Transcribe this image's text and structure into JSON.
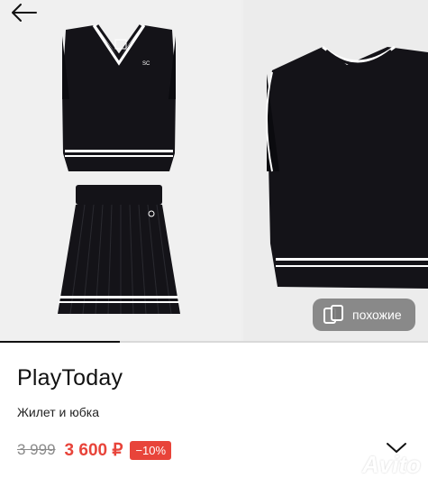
{
  "gallery": {
    "images": [
      {
        "icon": "vest-and-skirt-photo"
      },
      {
        "icon": "vest-closeup-photo"
      }
    ],
    "progress": 0.28,
    "similar_label": "похожие"
  },
  "product": {
    "brand": "PlayToday",
    "title": "Жилет и юбка",
    "old_price": "3 999",
    "price": "3 600 ₽",
    "discount": "−10%"
  },
  "watermark": {
    "text": "Avito"
  },
  "colors": {
    "accent": "#e8443a",
    "garment": "#141318",
    "trim": "#ffffff"
  }
}
